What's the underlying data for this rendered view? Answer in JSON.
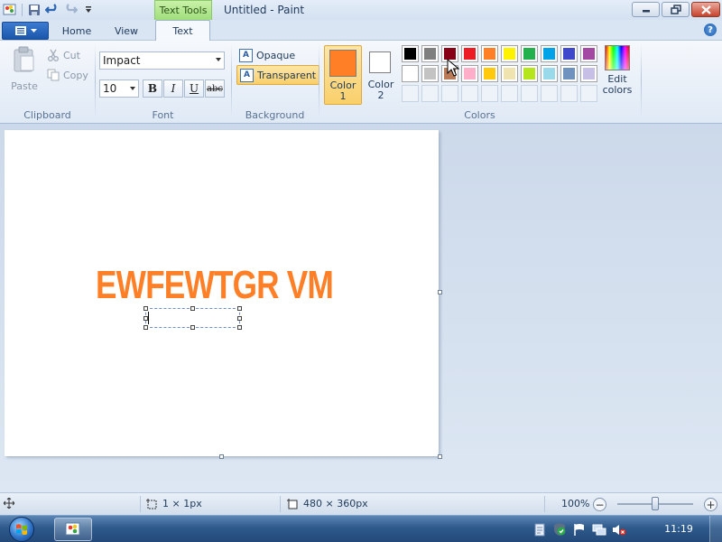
{
  "window": {
    "title": "Untitled - Paint",
    "context_tab": "Text Tools",
    "help": "?"
  },
  "tabs": {
    "home": "Home",
    "view": "View",
    "text": "Text"
  },
  "clipboard": {
    "paste": "Paste",
    "cut": "Cut",
    "copy": "Copy",
    "label": "Clipboard"
  },
  "font": {
    "family": "Impact",
    "size": "10",
    "bold": "B",
    "italic": "I",
    "underline": "U",
    "strike": "abc",
    "label": "Font"
  },
  "background": {
    "opaque": "Opaque",
    "transparent": "Transparent",
    "selected": "Transparent",
    "label": "Background"
  },
  "colors": {
    "color1_line1": "Color",
    "color1_line2": "1",
    "color1_value": "#ff7f27",
    "color2_line1": "Color",
    "color2_line2": "2",
    "color2_value": "#ffffff",
    "palette_row1": [
      "#000000",
      "#7f7f7f",
      "#880015",
      "#ed1c24",
      "#ff7f27",
      "#fff200",
      "#22b14c",
      "#00a2e8",
      "#3f48cc",
      "#a349a4"
    ],
    "palette_row2": [
      "#ffffff",
      "#c3c3c3",
      "#b97a57",
      "#ffaec9",
      "#ffc90e",
      "#efe4b0",
      "#b5e61d",
      "#99d9ea",
      "#7092be",
      "#c8bfe7"
    ],
    "edit_line1": "Edit",
    "edit_line2": "colors",
    "label": "Colors"
  },
  "canvas": {
    "text": "EWFEWTGR VM",
    "text_color": "#ff7f27"
  },
  "status": {
    "selection_size": "1 × 1px",
    "canvas_size": "480 × 360px",
    "zoom": "100%",
    "zoom_level": 1.0
  },
  "taskbar": {
    "time": "11:19"
  }
}
